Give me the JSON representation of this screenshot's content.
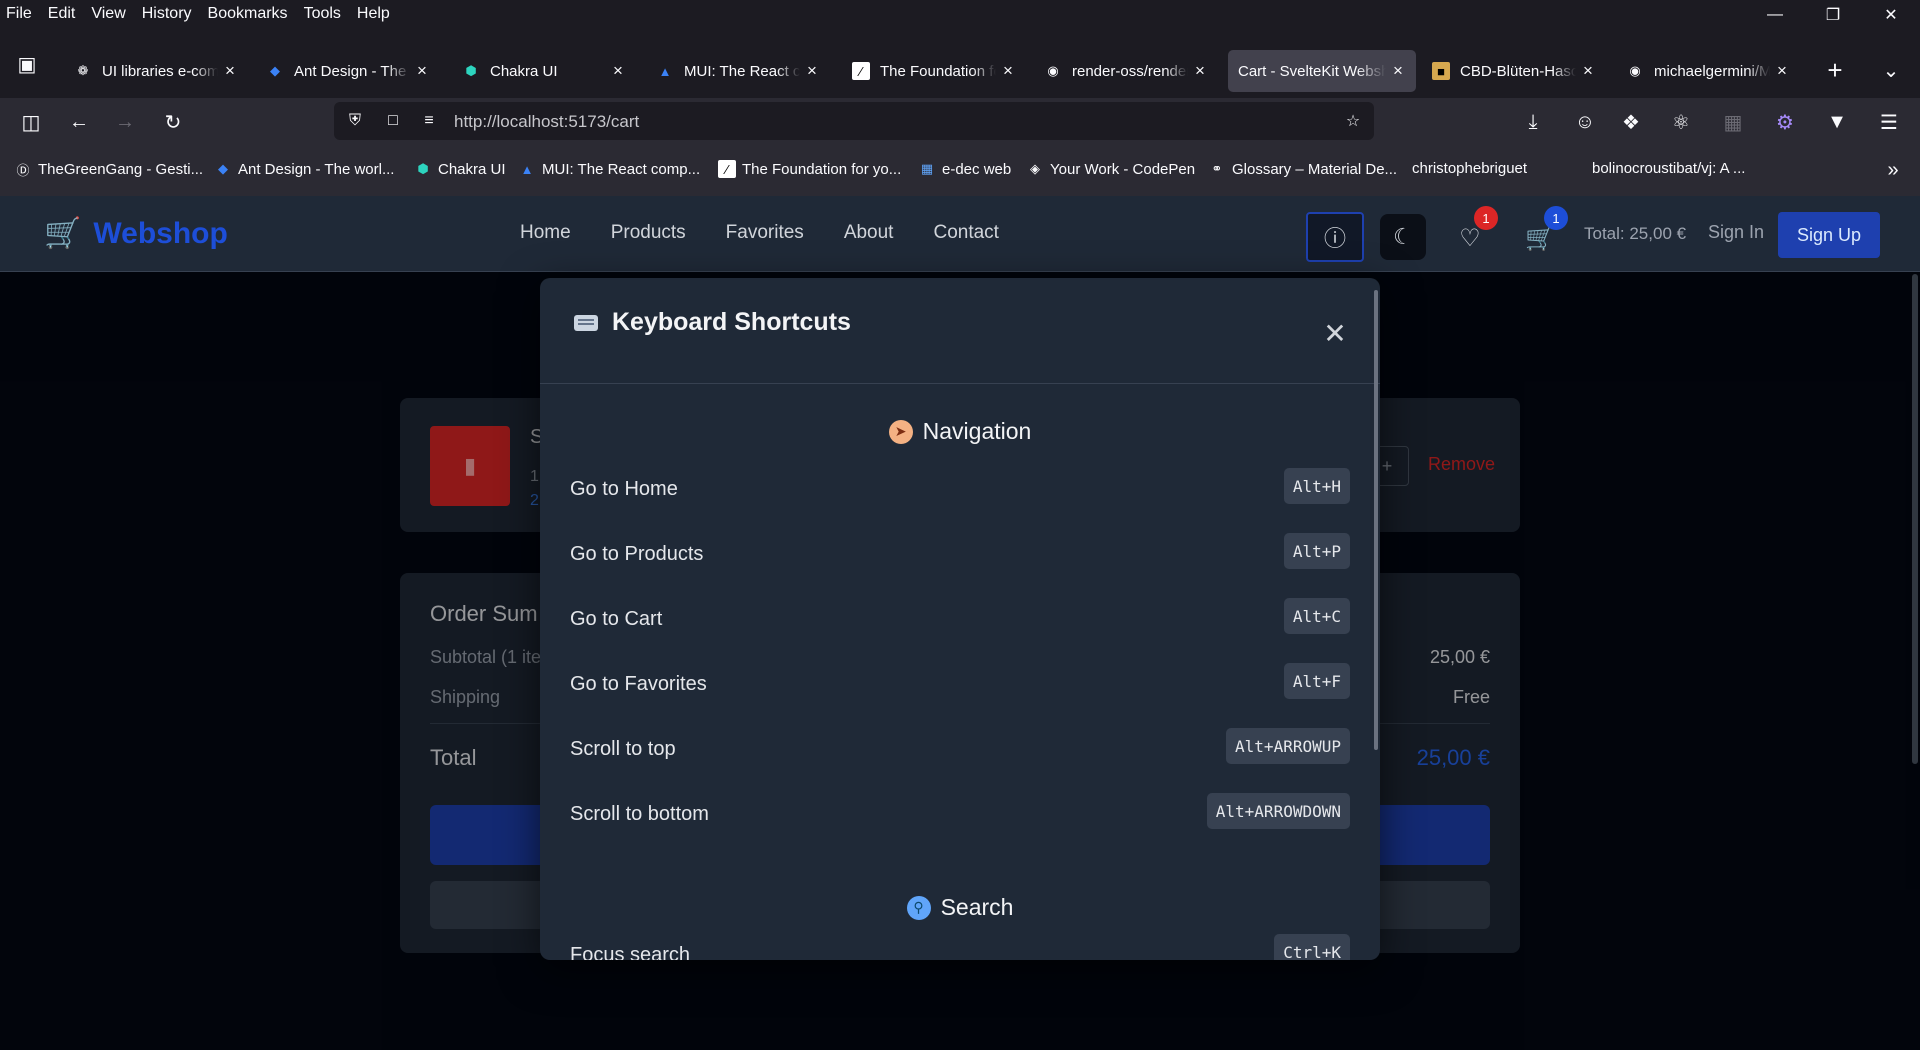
{
  "menubar": {
    "items": [
      "File",
      "Edit",
      "View",
      "History",
      "Bookmarks",
      "Tools",
      "Help"
    ]
  },
  "tabs": [
    {
      "title": "UI libraries e-comm",
      "icon": "openai-icon"
    },
    {
      "title": "Ant Design - The w",
      "icon": "antdesign-icon"
    },
    {
      "title": "Chakra UI",
      "icon": "chakra-icon"
    },
    {
      "title": "MUI: The React co",
      "icon": "mui-icon"
    },
    {
      "title": "The Foundation fo",
      "icon": "foundation-icon"
    },
    {
      "title": "render-oss/render",
      "icon": "github-icon"
    },
    {
      "title": "Cart - SvelteKit Websh",
      "icon": "none",
      "active": true
    },
    {
      "title": "CBD-Blüten-Hasch",
      "icon": "image-icon"
    },
    {
      "title": "michaelgermini/M",
      "icon": "github-icon"
    }
  ],
  "url": "http://localhost:5173/cart",
  "bookmarks": [
    {
      "label": "TheGreenGang - Gesti...",
      "icon": "wordpress-icon"
    },
    {
      "label": "Ant Design - The worl...",
      "icon": "antdesign-icon"
    },
    {
      "label": "Chakra UI",
      "icon": "chakra-icon"
    },
    {
      "label": "MUI: The React comp...",
      "icon": "mui-icon"
    },
    {
      "label": "The Foundation for yo...",
      "icon": "foundation-icon"
    },
    {
      "label": "e-dec web",
      "icon": "edec-icon"
    },
    {
      "label": "Your Work - CodePen",
      "icon": "codepen-icon"
    },
    {
      "label": "Glossary – Material De...",
      "icon": "globe-icon"
    },
    {
      "label": "christophebriguet",
      "icon": "none"
    },
    {
      "label": "bolinocroustibat/vj: A ...",
      "icon": "none"
    }
  ],
  "site": {
    "logo": "Webshop",
    "nav": [
      "Home",
      "Products",
      "Favorites",
      "About",
      "Contact"
    ],
    "favorites_count": "1",
    "cart_count": "1",
    "total": "Total: 25,00 €",
    "sign_in": "Sign In",
    "sign_up": "Sign Up"
  },
  "cart": {
    "item_name": "S",
    "item_qty": "1",
    "item_price": "2",
    "qty_plus": "+",
    "remove": "Remove",
    "summary_title": "Order Sum",
    "subtotal_label": "Subtotal (1 ite",
    "subtotal_value": "25,00 €",
    "shipping_label": "Shipping",
    "shipping_value": "Free",
    "total_label": "Total",
    "total_value": "25,00 €"
  },
  "modal": {
    "title": "Keyboard Shortcuts",
    "close": "✕",
    "sections": {
      "navigation": {
        "title": "Navigation",
        "shortcuts": [
          {
            "label": "Go to Home",
            "keys": "Alt+H"
          },
          {
            "label": "Go to Products",
            "keys": "Alt+P"
          },
          {
            "label": "Go to Cart",
            "keys": "Alt+C"
          },
          {
            "label": "Go to Favorites",
            "keys": "Alt+F"
          },
          {
            "label": "Scroll to top",
            "keys": "Alt+ARROWUP"
          },
          {
            "label": "Scroll to bottom",
            "keys": "Alt+ARROWDOWN"
          }
        ]
      },
      "search": {
        "title": "Search",
        "shortcuts": [
          {
            "label": "Focus search",
            "keys": "Ctrl+K"
          }
        ]
      }
    }
  },
  "colors": {
    "brand": "#1d4ed8",
    "danger": "#dc2626",
    "modal_bg": "#1f2937",
    "page_bg": "#030712"
  }
}
